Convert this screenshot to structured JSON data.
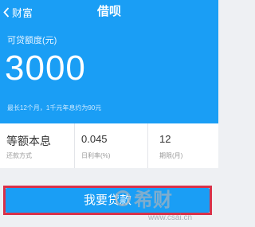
{
  "nav": {
    "back_label": "财富",
    "title": "借呗"
  },
  "hero": {
    "amount_label": "可贷额度(元)",
    "amount": "3000",
    "note": "最长12个月，1千元年息约为90元"
  },
  "info": [
    {
      "value": "等额本息",
      "label": "还款方式"
    },
    {
      "value": "0.045",
      "label": "日利率(%)"
    },
    {
      "value": "12",
      "label": "期限(月)"
    }
  ],
  "action": {
    "button_label": "我要贷款"
  },
  "watermark": {
    "logo_text": "希财",
    "url": "www.csai.cn"
  },
  "colors": {
    "primary": "#1a9ef5",
    "highlight": "#d9324a",
    "background": "#eef0f3"
  }
}
